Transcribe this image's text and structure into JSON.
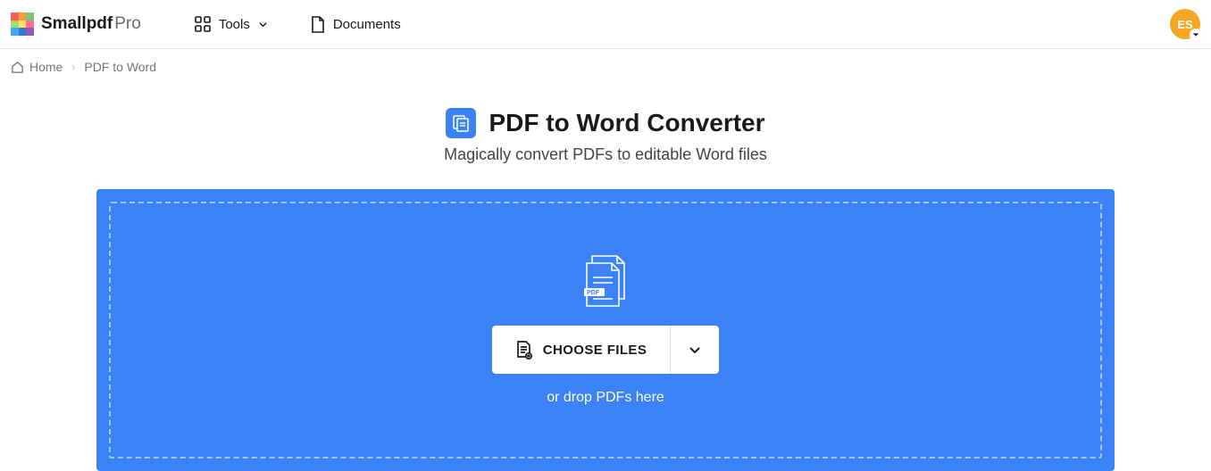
{
  "header": {
    "brand": "Smallpdf",
    "brand_suffix": "Pro",
    "nav": {
      "tools": "Tools",
      "documents": "Documents"
    },
    "avatar_initials": "ES"
  },
  "breadcrumb": {
    "home": "Home",
    "current": "PDF to Word"
  },
  "page": {
    "title": "PDF to Word Converter",
    "subtitle": "Magically convert PDFs to editable Word files"
  },
  "dropzone": {
    "choose_label": "CHOOSE FILES",
    "alt_text": "or drop PDFs here",
    "badge": "PDF"
  }
}
